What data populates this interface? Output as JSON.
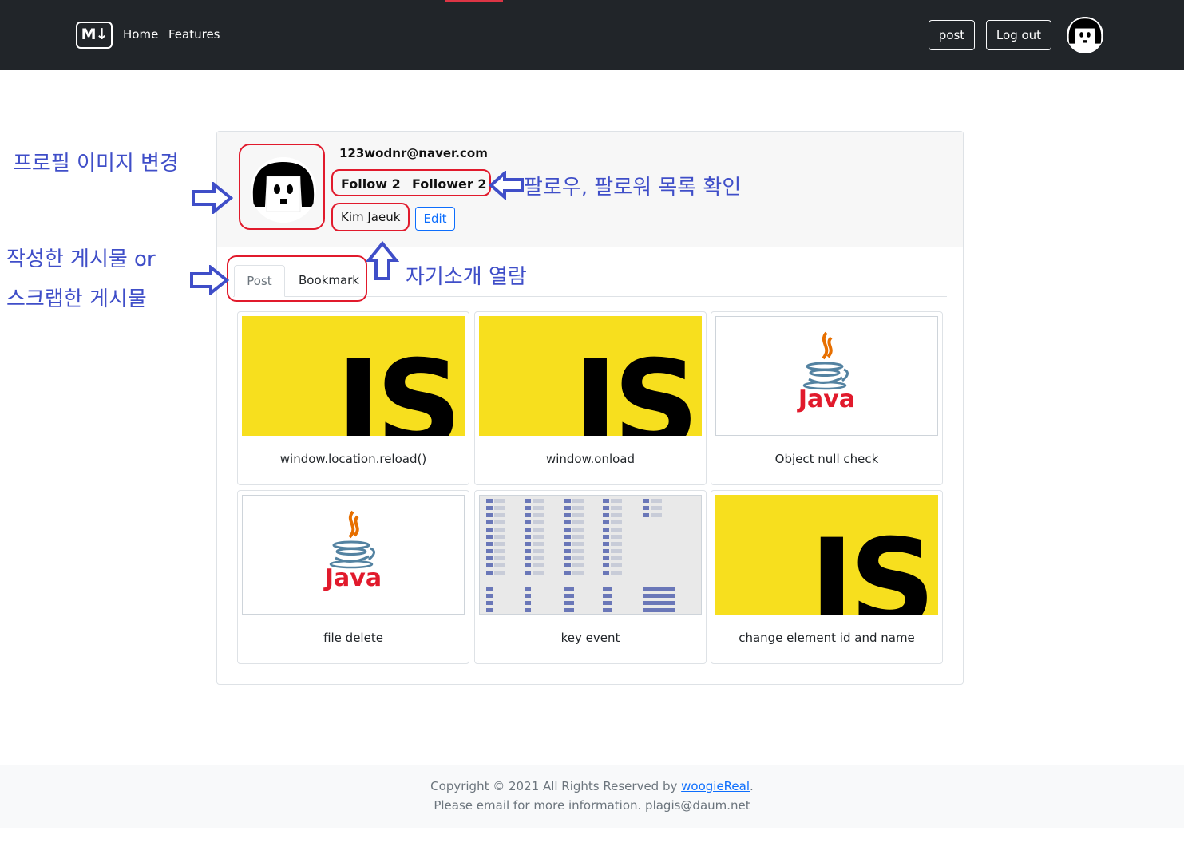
{
  "navbar": {
    "brand": "M↓",
    "links": [
      "Home",
      "Features"
    ],
    "post_button": "post",
    "logout_button": "Log out"
  },
  "profile": {
    "email": "123wodnr@naver.com",
    "follow_label": "Follow 2",
    "follower_label": "Follower 2",
    "username": "Kim Jaeuk",
    "edit_button": "Edit"
  },
  "tabs": [
    {
      "label": "Post",
      "active": true
    },
    {
      "label": "Bookmark",
      "active": false
    }
  ],
  "posts": [
    {
      "title": "window.location.reload()",
      "thumbnail": "js-logo"
    },
    {
      "title": "window.onload",
      "thumbnail": "js-logo"
    },
    {
      "title": "Object null check",
      "thumbnail": "java-logo"
    },
    {
      "title": "file delete",
      "thumbnail": "java-logo"
    },
    {
      "title": "key event",
      "thumbnail": "keycode-table"
    },
    {
      "title": "change element id and name",
      "thumbnail": "js-logo"
    }
  ],
  "logo_text": {
    "js": "JS",
    "java": "Java"
  },
  "footer": {
    "copyright_prefix": "Copyright © 2021 All Rights Reserved by ",
    "author_link": "woogieReal",
    "copyright_suffix": ".",
    "contact": "Please email for more information. plagis@daum.net"
  },
  "annotations": {
    "profile_image": "프로필 이미지 변경",
    "follow_list": "팔로우, 팔로워 목록  확인",
    "intro": "자기소개 열람",
    "posts_line1": "작성한 게시물 or",
    "posts_line2": "스크랩한 게시물"
  },
  "colors": {
    "navbar": "#212529",
    "annotation": "#3f4ec8",
    "highlight": "#e11a2c",
    "js_yellow": "#f7df1e"
  }
}
